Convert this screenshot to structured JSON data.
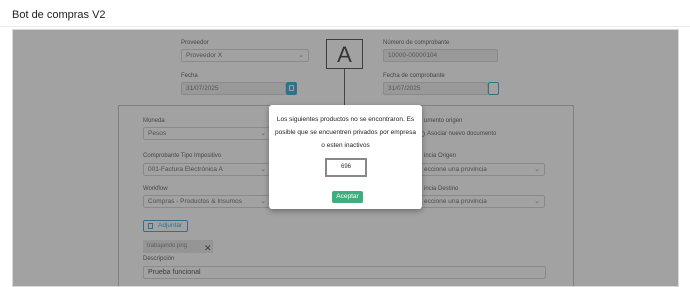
{
  "header": {
    "title": "Bot de compras V2"
  },
  "form": {
    "proveedor": {
      "label": "Proveedor",
      "value": "Proveedor X"
    },
    "numero": {
      "label": "Número de comprobante",
      "value": "10000-00000104"
    },
    "fecha": {
      "label": "Fecha",
      "value": "31/07/2025"
    },
    "fecha_comprobante": {
      "label": "Fecha de comprobante",
      "value": "31/07/2025"
    },
    "moneda": {
      "label": "Moneda",
      "value": "Pesos"
    },
    "documento_origen": {
      "label": "umento origen",
      "option": "Asociar nuevo documento"
    },
    "comprobante_tipo": {
      "label": "Comprobante Tipo Impositivo",
      "value": "001-Factura Electrónica A"
    },
    "provincia_origen": {
      "label": "incia Origen",
      "value": "eccione una provincia"
    },
    "workflow": {
      "label": "Workflow",
      "value": "Compras - Productos & Insumos"
    },
    "provincia_destino": {
      "label": "incia Destino",
      "value": "eccione una provincia"
    },
    "adjuntar_label": "Adjuntar",
    "file_name": "trabajando.png",
    "descripcion": {
      "label": "Descripción",
      "value": "Prueba funcional"
    }
  },
  "logo": {
    "letter": "A"
  },
  "modal": {
    "message": "Los siguientes productos no se encontraron. Es posible que se encuentren privados por empresa o esten inactivos",
    "code": "696",
    "accept_label": "Aceptar"
  },
  "colors": {
    "accent": "#1a9fd6",
    "success": "#3fae7e",
    "chevron": "#3aa3b8"
  }
}
